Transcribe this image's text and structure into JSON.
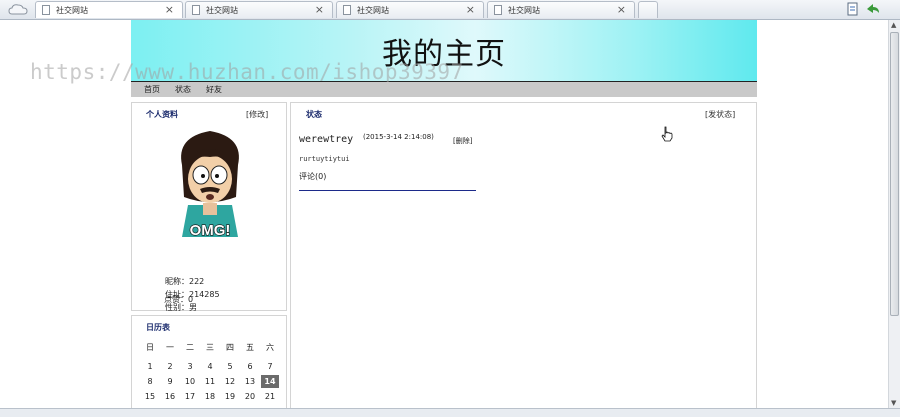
{
  "browser": {
    "tabs": [
      {
        "label": "社交网站",
        "close": "×"
      },
      {
        "label": "社交网站",
        "close": "×"
      },
      {
        "label": "社交网站",
        "close": "×"
      },
      {
        "label": "社交网站",
        "close": "×"
      }
    ]
  },
  "site": {
    "title": "我的主页",
    "watermark": "https://www.huzhan.com/ishop39397"
  },
  "nav": {
    "items": [
      "首页",
      "状态",
      "好友"
    ]
  },
  "profile": {
    "title": "个人资料",
    "edit_link": "[修改]",
    "avatar_caption": "OMG!",
    "fields": [
      {
        "label": "昵称：",
        "value": "222"
      },
      {
        "label": "住址：",
        "value": "214285"
      },
      {
        "label": "性别：",
        "value": "男"
      },
      {
        "label": "点赞：",
        "value": "0"
      }
    ]
  },
  "status": {
    "title": "状态",
    "post_link": "[发状态]",
    "post": {
      "user": "werewtrey",
      "time": "(2015-3-14 2:14:08)",
      "delete": "[删除]",
      "content": "rurtuytiytui",
      "comments": "评论(0)"
    }
  },
  "calendar": {
    "title": "日历表",
    "weekdays": [
      "日",
      "一",
      "二",
      "三",
      "四",
      "五",
      "六"
    ],
    "rows": [
      [
        "1",
        "2",
        "3",
        "4",
        "5",
        "6",
        "7"
      ],
      [
        "8",
        "9",
        "10",
        "11",
        "12",
        "13",
        "14"
      ],
      [
        "15",
        "16",
        "17",
        "18",
        "19",
        "20",
        "21"
      ]
    ],
    "today": "14"
  }
}
